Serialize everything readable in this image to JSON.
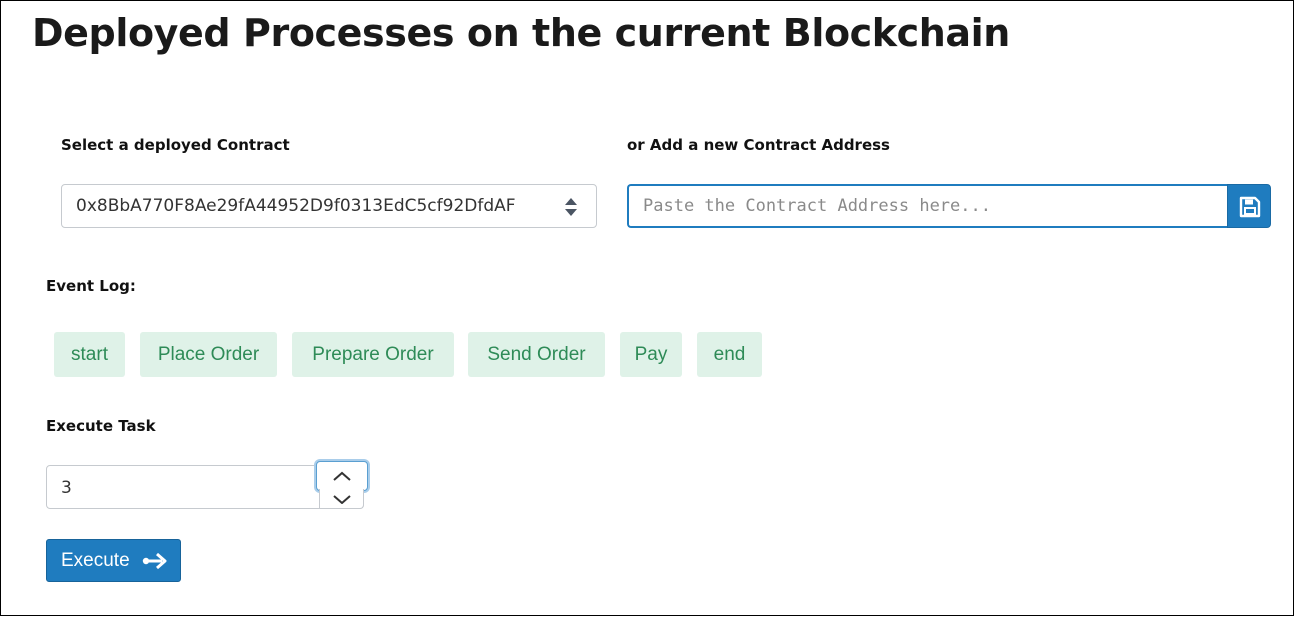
{
  "page": {
    "title": "Deployed Processes on the current Blockchain"
  },
  "contract": {
    "select_label": "Select a deployed Contract",
    "selected_value": "0x8BbA770F8Ae29fA44952D9f0313EdC5cf92DfdAF",
    "add_label": "or Add a new Contract Address",
    "add_placeholder": "Paste the Contract Address here...",
    "save_icon": "save-icon"
  },
  "event_log": {
    "label": "Event Log:",
    "events": [
      "start",
      "Place Order",
      "Prepare Order",
      "Send Order",
      "Pay",
      "end"
    ],
    "badge_bg": "#dff2e8",
    "badge_text": "#2e8b57"
  },
  "execute": {
    "label": "Execute Task",
    "task_value": "3",
    "button_label": "Execute",
    "button_icon": "sign-in-arrow-icon"
  },
  "colors": {
    "accent": "#1f7cbf"
  }
}
